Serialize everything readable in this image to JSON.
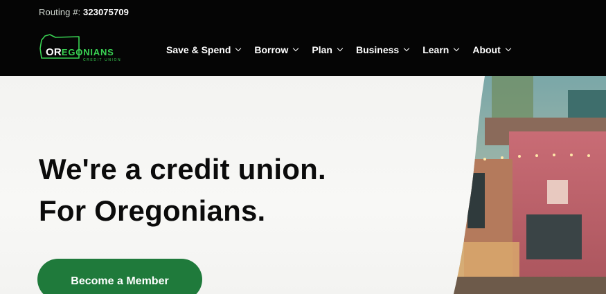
{
  "routing": {
    "label": "Routing #:",
    "number": "323075709"
  },
  "logo": {
    "prefix": "OR",
    "rest": "EGONIANS",
    "subtitle": "CREDIT UNION"
  },
  "nav": [
    {
      "label": "Save & Spend"
    },
    {
      "label": "Borrow"
    },
    {
      "label": "Plan"
    },
    {
      "label": "Business"
    },
    {
      "label": "Learn"
    },
    {
      "label": "About"
    }
  ],
  "hero": {
    "line1": "We're a credit union.",
    "line2": "For Oregonians.",
    "cta": "Become a Member"
  },
  "colors": {
    "topbar": "#050505",
    "brand_green": "#39d353",
    "cta_green": "#1f7a3b",
    "heading": "#0b0b0b"
  },
  "icons": [
    "oregon-state-outline-icon",
    "chevron-down-icon"
  ]
}
